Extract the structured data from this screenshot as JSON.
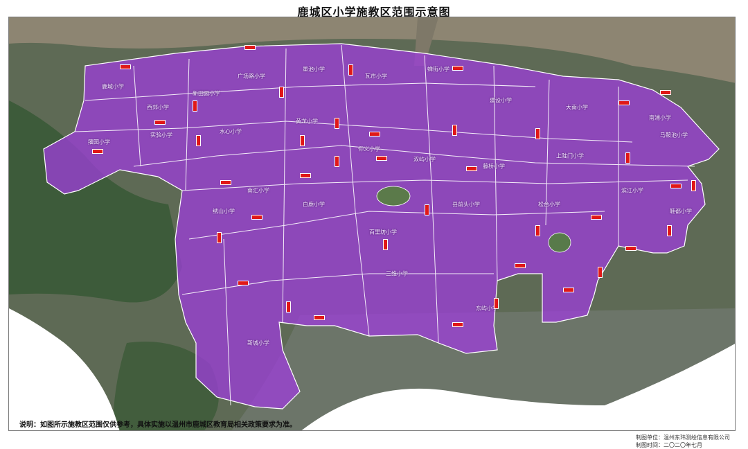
{
  "title": "鹿城区小学施教区范围示意图",
  "note": "说明：如图所示施教区范围仅供参考，具体实施以温州市鹿城区教育局相关政策要求为准。",
  "credits": {
    "maker": "制图单位：温州东玮测绘信息有限公司",
    "date": "制图时间：二〇二〇年七月"
  },
  "colors": {
    "zone_fill": "#9b3fd6",
    "zone_border": "#ffffff",
    "river": "#8c8472",
    "land": "#5d6b52",
    "hills": "#3e5a3a",
    "road_tag": "#e01818"
  },
  "school_labels": [
    "鹿城小学",
    "西郊小学",
    "新田园小学",
    "广场路小学",
    "墨池小学",
    "瓦市小学",
    "蝉街小学",
    "建设小学",
    "大南小学",
    "南浦小学",
    "籀园小学",
    "实验小学",
    "水心小学",
    "黄龙小学",
    "仰义小学",
    "双屿小学",
    "藤桥小学",
    "上陡门小学",
    "马鞍池小学",
    "绣山小学",
    "南汇小学",
    "白鹿小学",
    "百里坊小学",
    "县前头小学",
    "松台小学",
    "滨江小学",
    "鞋都小学",
    "三维小学",
    "东屿小学",
    "新城小学"
  ]
}
